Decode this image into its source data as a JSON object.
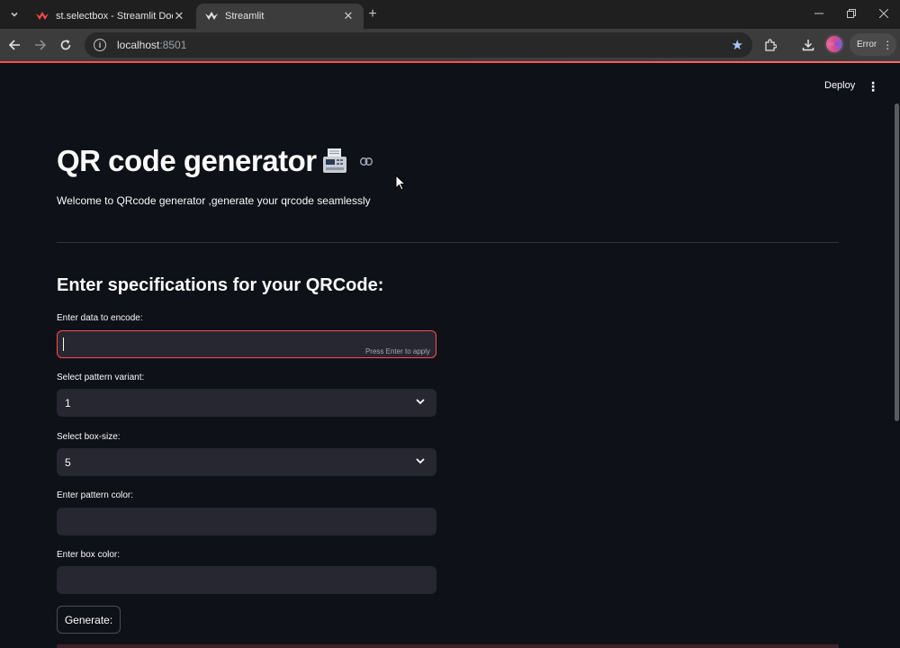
{
  "browser": {
    "tabs": [
      {
        "title": "st.selectbox - Streamlit Docs",
        "active": false
      },
      {
        "title": "Streamlit",
        "active": true
      }
    ],
    "address": {
      "host": "localhost",
      "port": ":8501"
    },
    "profile_status": "Error"
  },
  "colors": {
    "accent": "#ff4b4b",
    "background": "#0e1117",
    "input_bg": "#262730"
  },
  "header": {
    "deploy_label": "Deploy"
  },
  "page": {
    "title": "QR code generator",
    "subtitle": "Welcome to QRcode generator ,generate your qrcode seamlessly",
    "section_title": "Enter specifications for your QRCode:"
  },
  "form": {
    "data_label": "Enter data to encode:",
    "data_value": "",
    "data_hint": "Press Enter to apply",
    "pattern_label": "Select pattern variant:",
    "pattern_value": "1",
    "box_size_label": "Select box-size:",
    "box_size_value": "5",
    "pattern_color_label": "Enter pattern color:",
    "pattern_color_value": "",
    "box_color_label": "Enter box color:",
    "box_color_value": "",
    "generate_label": "Generate:"
  },
  "icons": {
    "title_emoji": "fax-icon",
    "anchor": "link-icon",
    "select_chevron": "chevron-down-icon"
  }
}
